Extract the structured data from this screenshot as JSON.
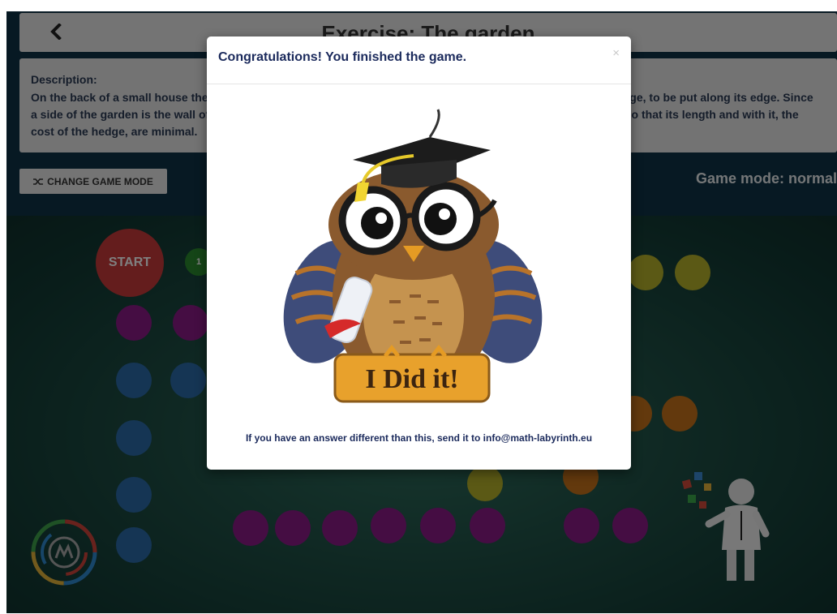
{
  "header": {
    "title": "Exercise: The garden"
  },
  "description": {
    "heading": "Description:",
    "text": "On the back of a small house there is a garden of the shape of a rectangle. The owner wants to buy a small hedge, to be put along its edge. Since a side of the garden is the wall of the house, the hedge will not go there. The owner wants the garden to have, so that its length and with it, the cost of the hedge, are minimal."
  },
  "controls": {
    "change_mode_label": "CHANGE GAME MODE",
    "mode_status": "Game mode: normal"
  },
  "board": {
    "start_label": "START",
    "first_step_label": "1"
  },
  "modal": {
    "title": "Congratulations! You finished the game.",
    "close_symbol": "×",
    "banner_text": "I Did it!",
    "note": "If you have an answer different than this, send it to info@math-labyrinth.eu"
  },
  "colors": {
    "start": "#c93a3a",
    "purple": "#8a1a86",
    "blue": "#2a6aa8",
    "yellow": "#b7b32b",
    "orange": "#c6731b",
    "green": "#27a83a"
  }
}
